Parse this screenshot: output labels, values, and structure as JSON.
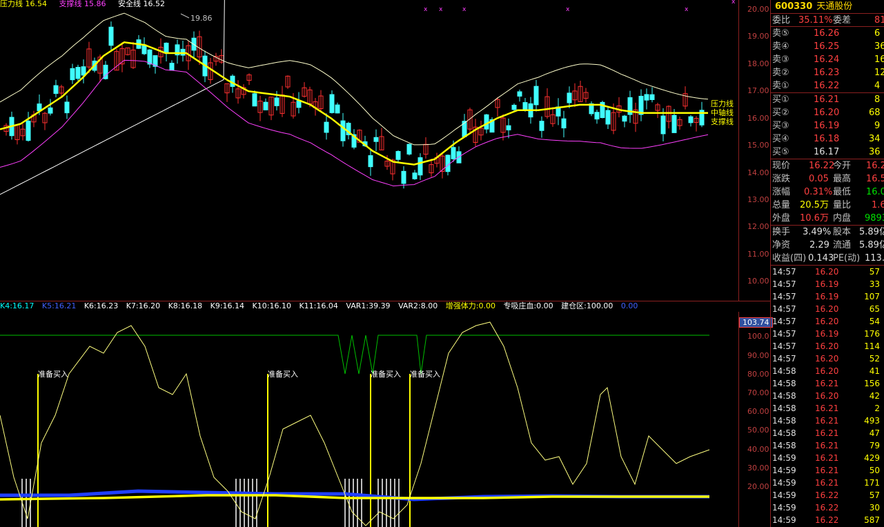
{
  "top_legend": [
    {
      "text": "压力线 16.54",
      "color": "#ffff00"
    },
    {
      "text": "支撑线 15.86",
      "color": "#ff40ff"
    },
    {
      "text": "安全线 16.52",
      "color": "#ffffff"
    }
  ],
  "peak_label": "19.86",
  "line_labels": [
    "压力线",
    "中轴线",
    "支撑线"
  ],
  "price_axis": [
    "20.00",
    "19.00",
    "18.00",
    "17.00",
    "16.00",
    "15.00",
    "14.00",
    "13.00",
    "12.00",
    "11.00",
    "10.00"
  ],
  "ind_axis": [
    "100.0",
    "90.00",
    "80.00",
    "70.00",
    "60.00",
    "50.00",
    "40.00",
    "30.00",
    "20.00"
  ],
  "ind_badge": "103.74",
  "ind_legend": [
    {
      "text": "K4:16.17",
      "color": "#00ffff"
    },
    {
      "text": "K5:16.21",
      "color": "#0000ff"
    },
    {
      "text": "K6:16.23",
      "color": "#ffffff"
    },
    {
      "text": "K7:16.20",
      "color": "#ffffff"
    },
    {
      "text": "K8:16.18",
      "color": "#ffffff"
    },
    {
      "text": "K9:16.14",
      "color": "#ffffff"
    },
    {
      "text": "K10:16.10",
      "color": "#ffffff"
    },
    {
      "text": "K11:16.04",
      "color": "#ffffff"
    },
    {
      "text": "VAR1:39.39",
      "color": "#ffffff"
    },
    {
      "text": "VAR2:8.00",
      "color": "#ffffff"
    },
    {
      "text": "增强体力:0.00",
      "color": "#ffff00"
    },
    {
      "text": "专吸庄血:0.00",
      "color": "#ffffff"
    },
    {
      "text": "建仓区:100.00",
      "color": "#ffffff"
    },
    {
      "text": "0.00",
      "color": "#0000ff"
    }
  ],
  "buy_label": "准备买入",
  "stock": {
    "code": "600330",
    "name": "天通股份"
  },
  "weibi": {
    "label1": "委比",
    "value1": "35.11%",
    "label2": "委差",
    "value2": "81"
  },
  "sell": [
    {
      "label": "卖⑤",
      "price": "16.26",
      "vol": "6"
    },
    {
      "label": "卖④",
      "price": "16.25",
      "vol": "36"
    },
    {
      "label": "卖③",
      "price": "16.24",
      "vol": "16"
    },
    {
      "label": "卖②",
      "price": "16.23",
      "vol": "12"
    },
    {
      "label": "卖①",
      "price": "16.22",
      "vol": "4"
    }
  ],
  "buy": [
    {
      "label": "买①",
      "price": "16.21",
      "vol": "8"
    },
    {
      "label": "买②",
      "price": "16.20",
      "vol": "68"
    },
    {
      "label": "买③",
      "price": "16.19",
      "vol": "9"
    },
    {
      "label": "买④",
      "price": "16.18",
      "vol": "34"
    },
    {
      "label": "买⑤",
      "price": "16.17",
      "vol": "36"
    }
  ],
  "quote": [
    {
      "l1": "现价",
      "v1": "16.22",
      "c1": "#ff4040",
      "l2": "今开",
      "v2": "16.2",
      "c2": "#ff4040"
    },
    {
      "l1": "涨跌",
      "v1": "0.05",
      "c1": "#ff4040",
      "l2": "最高",
      "v2": "16.5",
      "c2": "#ff4040"
    },
    {
      "l1": "涨幅",
      "v1": "0.31%",
      "c1": "#ff4040",
      "l2": "最低",
      "v2": "16.0",
      "c2": "#00e000"
    },
    {
      "l1": "总量",
      "v1": "20.5万",
      "c1": "#ffff00",
      "l2": "量比",
      "v2": "1.6",
      "c2": "#ff4040"
    },
    {
      "l1": "外盘",
      "v1": "10.6万",
      "c1": "#ff4040",
      "l2": "内盘",
      "v2": "9893",
      "c2": "#00e000"
    }
  ],
  "stats": [
    {
      "l1": "换手",
      "v1": "3.49%",
      "l2": "股本",
      "v2": "5.89亿"
    },
    {
      "l1": "净资",
      "v1": "2.29",
      "l2": "流通",
      "v2": "5.89亿"
    },
    {
      "l1": "收益(四)",
      "v1": "0.143",
      "l2": "PE(动)",
      "v2": "113."
    }
  ],
  "ticks": [
    {
      "t": "14:57",
      "p": "16.20",
      "v": "57",
      "c": "#ff4040"
    },
    {
      "t": "14:57",
      "p": "16.19",
      "v": "33",
      "c": "#00e000"
    },
    {
      "t": "14:57",
      "p": "16.19",
      "v": "107",
      "c": "#00e000"
    },
    {
      "t": "14:57",
      "p": "16.20",
      "v": "65",
      "c": "#ff4040"
    },
    {
      "t": "14:57",
      "p": "16.20",
      "v": "54",
      "c": "#ff4040"
    },
    {
      "t": "14:57",
      "p": "16.19",
      "v": "176",
      "c": "#00e000"
    },
    {
      "t": "14:57",
      "p": "16.20",
      "v": "114",
      "c": "#ff4040"
    },
    {
      "t": "14:57",
      "p": "16.20",
      "v": "52",
      "c": "#ff4040"
    },
    {
      "t": "14:58",
      "p": "16.20",
      "v": "41",
      "c": "#ff4040"
    },
    {
      "t": "14:58",
      "p": "16.21",
      "v": "156",
      "c": "#ff4040"
    },
    {
      "t": "14:58",
      "p": "16.20",
      "v": "42",
      "c": "#00e000"
    },
    {
      "t": "14:58",
      "p": "16.21",
      "v": "2",
      "c": "#ff4040"
    },
    {
      "t": "14:58",
      "p": "16.21",
      "v": "493",
      "c": "#ff4040"
    },
    {
      "t": "14:58",
      "p": "16.21",
      "v": "47",
      "c": "#ff4040"
    },
    {
      "t": "14:58",
      "p": "16.21",
      "v": "79",
      "c": "#ff4040"
    },
    {
      "t": "14:59",
      "p": "16.21",
      "v": "429",
      "c": "#ff4040"
    },
    {
      "t": "14:59",
      "p": "16.21",
      "v": "50",
      "c": "#ff4040"
    },
    {
      "t": "14:59",
      "p": "16.21",
      "v": "171",
      "c": "#ff4040"
    },
    {
      "t": "14:59",
      "p": "16.22",
      "v": "57",
      "c": "#ff4040"
    },
    {
      "t": "14:59",
      "p": "16.22",
      "v": "30",
      "c": "#ff4040"
    },
    {
      "t": "14:59",
      "p": "16.22",
      "v": "587",
      "c": "#ff4040"
    }
  ]
}
